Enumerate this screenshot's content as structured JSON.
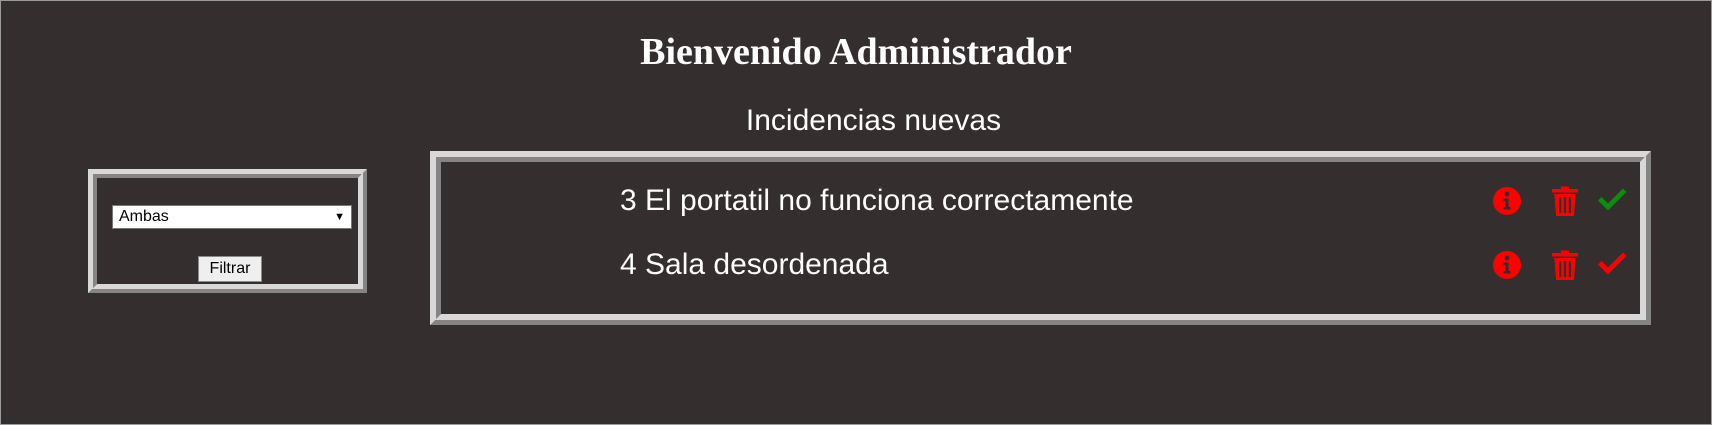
{
  "header": {
    "title": "Bienvenido Administrador"
  },
  "section": {
    "title": "Incidencias nuevas"
  },
  "filter": {
    "selected": "Ambas",
    "button_label": "Filtrar"
  },
  "incidents": [
    {
      "text": "3 El portatil no funciona correctamente",
      "icons": [
        "info-icon",
        "trash-icon",
        "check-icon"
      ],
      "check_color": "#0a8f0a"
    },
    {
      "text": "4 Sala desordenada",
      "icons": [
        "info-icon",
        "trash-icon",
        "check-icon"
      ],
      "check_color": "#ff0000"
    }
  ],
  "colors": {
    "background": "#342e2e",
    "text": "#ffffff",
    "action_red": "#ff0000",
    "approve_green": "#0a8f0a",
    "panel_border": "#d8d8d8"
  }
}
